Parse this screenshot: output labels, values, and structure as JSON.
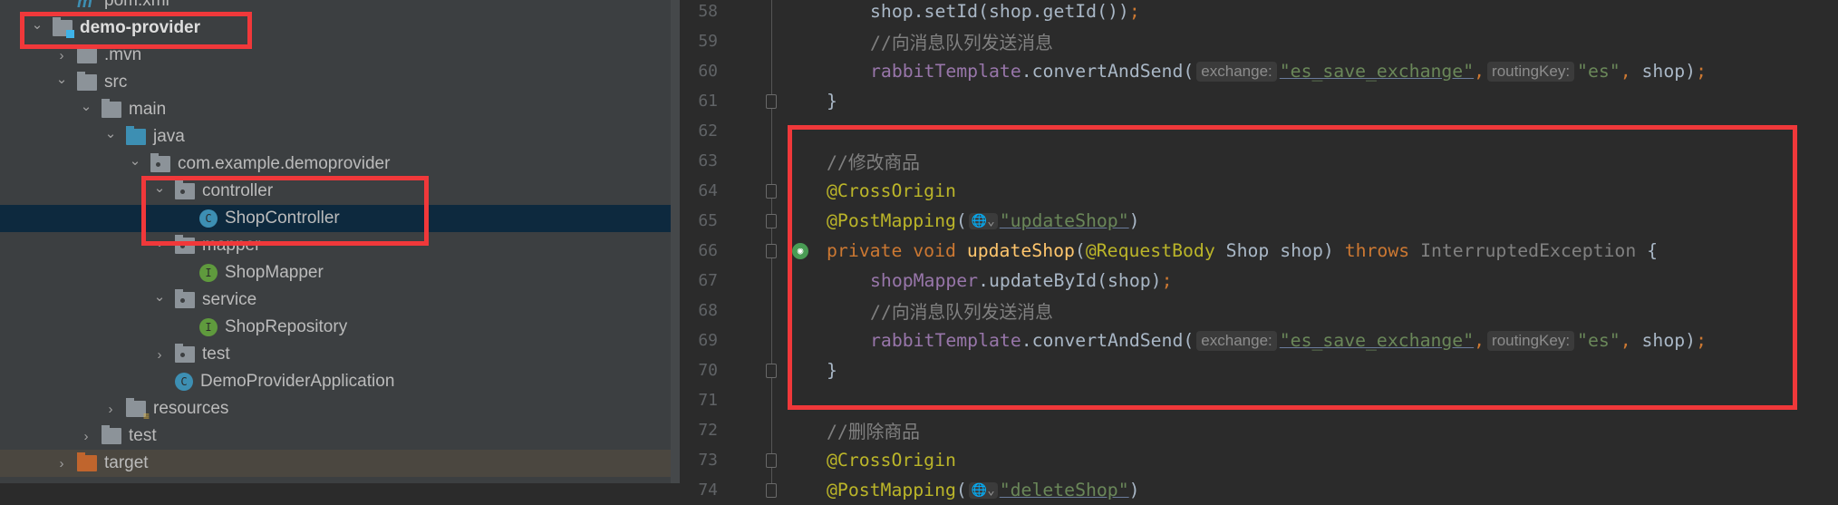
{
  "project_tree": [
    {
      "label": "pom.xml",
      "depth": 1,
      "arrow": "",
      "icon": "maven-file-icon"
    },
    {
      "label": "demo-provider",
      "depth": 0,
      "arrow": "down",
      "icon": "module-folder-icon",
      "bold": true
    },
    {
      "label": ".mvn",
      "depth": 1,
      "arrow": "right",
      "icon": "folder-icon"
    },
    {
      "label": "src",
      "depth": 1,
      "arrow": "down",
      "icon": "folder-icon"
    },
    {
      "label": "main",
      "depth": 2,
      "arrow": "down",
      "icon": "folder-icon"
    },
    {
      "label": "java",
      "depth": 3,
      "arrow": "down",
      "icon": "source-folder-icon"
    },
    {
      "label": "com.example.demoprovider",
      "depth": 4,
      "arrow": "down",
      "icon": "package-icon"
    },
    {
      "label": "controller",
      "depth": 5,
      "arrow": "down",
      "icon": "package-icon"
    },
    {
      "label": "ShopController",
      "depth": 6,
      "arrow": "",
      "icon": "class-icon",
      "badge": "C",
      "selected": true
    },
    {
      "label": "mapper",
      "depth": 5,
      "arrow": "down",
      "icon": "package-icon"
    },
    {
      "label": "ShopMapper",
      "depth": 6,
      "arrow": "",
      "icon": "interface-icon",
      "badge": "I"
    },
    {
      "label": "service",
      "depth": 5,
      "arrow": "down",
      "icon": "package-icon"
    },
    {
      "label": "ShopRepository",
      "depth": 6,
      "arrow": "",
      "icon": "interface-icon",
      "badge": "I"
    },
    {
      "label": "test",
      "depth": 5,
      "arrow": "right",
      "icon": "package-icon"
    },
    {
      "label": "DemoProviderApplication",
      "depth": 5,
      "arrow": "",
      "icon": "spring-boot-class-icon",
      "badge": "C"
    },
    {
      "label": "resources",
      "depth": 3,
      "arrow": "right",
      "icon": "resources-folder-icon"
    },
    {
      "label": "test",
      "depth": 2,
      "arrow": "right",
      "icon": "folder-icon"
    },
    {
      "label": "target",
      "depth": 1,
      "arrow": "right",
      "icon": "excluded-folder-icon",
      "excluded": true
    }
  ],
  "editor": {
    "lines": [
      {
        "n": "58",
        "indent": 1,
        "tokens": [
          [
            "shop.setId(shop.getId())",
            "id"
          ],
          [
            ";",
            "kw"
          ]
        ]
      },
      {
        "n": "59",
        "indent": 1,
        "tokens": [
          [
            "//向消息队列发送消息",
            "cmt"
          ]
        ]
      },
      {
        "n": "60",
        "indent": 1,
        "tokens": [
          [
            "rabbitTemplate",
            "field"
          ],
          [
            ".convertAndSend(",
            "id"
          ],
          [
            "exchange:",
            "hint"
          ],
          [
            "\"es_save_exchange\"",
            "link"
          ],
          [
            ",",
            "kw"
          ],
          [
            "routingKey:",
            "hint"
          ],
          [
            "\"es\"",
            "str"
          ],
          [
            ",",
            "kw"
          ],
          [
            " shop)",
            "id"
          ],
          [
            ";",
            "kw"
          ]
        ]
      },
      {
        "n": "61",
        "indent": 0,
        "fold": true,
        "tokens": [
          [
            "}",
            "id"
          ]
        ]
      },
      {
        "n": "62",
        "indent": 0,
        "tokens": []
      },
      {
        "n": "63",
        "indent": 0,
        "tokens": [
          [
            "//修改商品",
            "cmt"
          ]
        ]
      },
      {
        "n": "64",
        "indent": 0,
        "fold": true,
        "tokens": [
          [
            "@CrossOrigin",
            "ann"
          ]
        ]
      },
      {
        "n": "65",
        "indent": 0,
        "fold": true,
        "tokens": [
          [
            "@PostMapping",
            "ann"
          ],
          [
            "(",
            "id"
          ],
          [
            "🌐⌄",
            "globe"
          ],
          [
            "\"updateShop\"",
            "link"
          ],
          [
            ")",
            "id"
          ]
        ]
      },
      {
        "n": "66",
        "indent": 0,
        "fold": true,
        "run": true,
        "tokens": [
          [
            "private void ",
            "kw"
          ],
          [
            "updateShop",
            "fn"
          ],
          [
            "(",
            "id"
          ],
          [
            "@RequestBody",
            "ann"
          ],
          [
            " Shop shop) ",
            "id"
          ],
          [
            "throws ",
            "kw"
          ],
          [
            "InterruptedException",
            "type"
          ],
          [
            " {",
            "id"
          ]
        ]
      },
      {
        "n": "67",
        "indent": 1,
        "tokens": [
          [
            "shopMapper",
            "field"
          ],
          [
            ".updateById(shop)",
            "id"
          ],
          [
            ";",
            "kw"
          ]
        ]
      },
      {
        "n": "68",
        "indent": 1,
        "tokens": [
          [
            "//向消息队列发送消息",
            "cmt"
          ]
        ]
      },
      {
        "n": "69",
        "indent": 1,
        "tokens": [
          [
            "rabbitTemplate",
            "field"
          ],
          [
            ".convertAndSend(",
            "id"
          ],
          [
            "exchange:",
            "hint"
          ],
          [
            "\"es_save_exchange\"",
            "link"
          ],
          [
            ",",
            "kw"
          ],
          [
            "routingKey:",
            "hint"
          ],
          [
            "\"es\"",
            "str"
          ],
          [
            ",",
            "kw"
          ],
          [
            " shop)",
            "id"
          ],
          [
            ";",
            "kw"
          ]
        ]
      },
      {
        "n": "70",
        "indent": 0,
        "fold": true,
        "tokens": [
          [
            "}",
            "id"
          ]
        ]
      },
      {
        "n": "71",
        "indent": 0,
        "tokens": []
      },
      {
        "n": "72",
        "indent": 0,
        "tokens": [
          [
            "//删除商品",
            "cmt"
          ]
        ]
      },
      {
        "n": "73",
        "indent": 0,
        "fold": true,
        "tokens": [
          [
            "@CrossOrigin",
            "ann"
          ]
        ]
      },
      {
        "n": "74",
        "indent": 0,
        "fold": true,
        "tokens": [
          [
            "@PostMapping",
            "ann"
          ],
          [
            "(",
            "id"
          ],
          [
            "🌐⌄",
            "globe"
          ],
          [
            "\"deleteShop\"",
            "link"
          ],
          [
            ")",
            "id"
          ]
        ]
      }
    ]
  },
  "highlight_color": "#f0383a"
}
